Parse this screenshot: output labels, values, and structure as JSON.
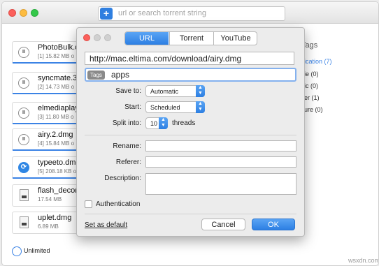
{
  "search": {
    "placeholder": "url or search torrent string",
    "add_label": "+"
  },
  "downloads": [
    {
      "name": "PhotoBulk.d",
      "meta": "[1] 15.82 MB o",
      "icon": "pause-icon",
      "status_glyph": "II"
    },
    {
      "name": "syncmate.3",
      "meta": "[2] 14.73 MB o",
      "icon": "pause-icon",
      "status_glyph": "II"
    },
    {
      "name": "elmediaplay",
      "meta": "[3] 11.80 MB o",
      "icon": "pause-icon",
      "status_glyph": "II"
    },
    {
      "name": "airy.2.dmg",
      "meta": "[4] 15.84 MB o",
      "icon": "pause-icon",
      "status_glyph": "II"
    },
    {
      "name": "typeeto.dmg",
      "meta": "[5] 208.18 KB o",
      "icon": "refresh-icon",
      "status_glyph": "⟳"
    },
    {
      "name": "flash_decor",
      "meta": "17.54 MB",
      "icon": "file-icon",
      "status_glyph": ""
    },
    {
      "name": "uplet.dmg",
      "meta": "6.89 MB",
      "icon": "file-icon",
      "status_glyph": ""
    }
  ],
  "sidebar": {
    "title": "Tags",
    "items": [
      {
        "label": "ication (7)"
      },
      {
        "label": "ie (0)"
      },
      {
        "label": "ic (0)"
      },
      {
        "label": "er (1)"
      },
      {
        "label": "ure (0)"
      }
    ]
  },
  "status": {
    "speed_label": "Unlimited"
  },
  "watermark": "wsxdn.com",
  "dialog": {
    "tabs": [
      {
        "label": "URL",
        "active": true
      },
      {
        "label": "Torrent",
        "active": false
      },
      {
        "label": "YouTube",
        "active": false
      }
    ],
    "url_value": "http://mac.eltima.com/download/airy.dmg",
    "tags_chip": "Tags",
    "tags_value": "apps",
    "save_to_label": "Save to:",
    "save_to_value": "Automatic",
    "start_label": "Start:",
    "start_value": "Scheduled",
    "split_label": "Split into:",
    "split_value": "10",
    "split_unit": "threads",
    "rename_label": "Rename:",
    "referer_label": "Referer:",
    "description_label": "Description:",
    "authentication_label": "Authentication",
    "set_default_label": "Set as default",
    "cancel_label": "Cancel",
    "ok_label": "OK"
  },
  "colors": {
    "accent": "#2f7fe0",
    "progress": "#3b83e5",
    "close": "#fc605b",
    "minimize": "#fdbc40",
    "zoom": "#34c84a"
  }
}
